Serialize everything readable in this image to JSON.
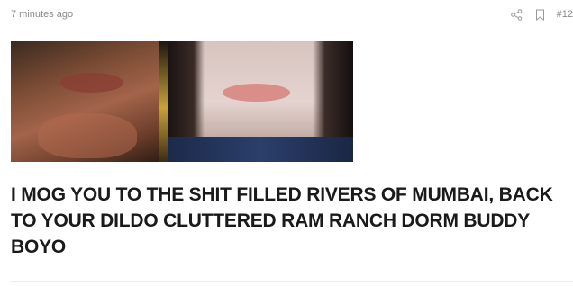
{
  "post": {
    "timestamp": "7 minutes ago",
    "post_number": "#12",
    "title": "I MOG YOU TO THE SHIT FILLED RIVERS OF MUMBAI, BACK TO YOUR DILDO CLUTTERED RAM RANCH DORM BUDDY BOYO"
  },
  "icons": {
    "share": "share-icon",
    "bookmark": "bookmark-icon"
  },
  "colors": {
    "meta_text": "#8a8a8a",
    "title_text": "#1a1a1a",
    "divider": "#ebebeb"
  }
}
